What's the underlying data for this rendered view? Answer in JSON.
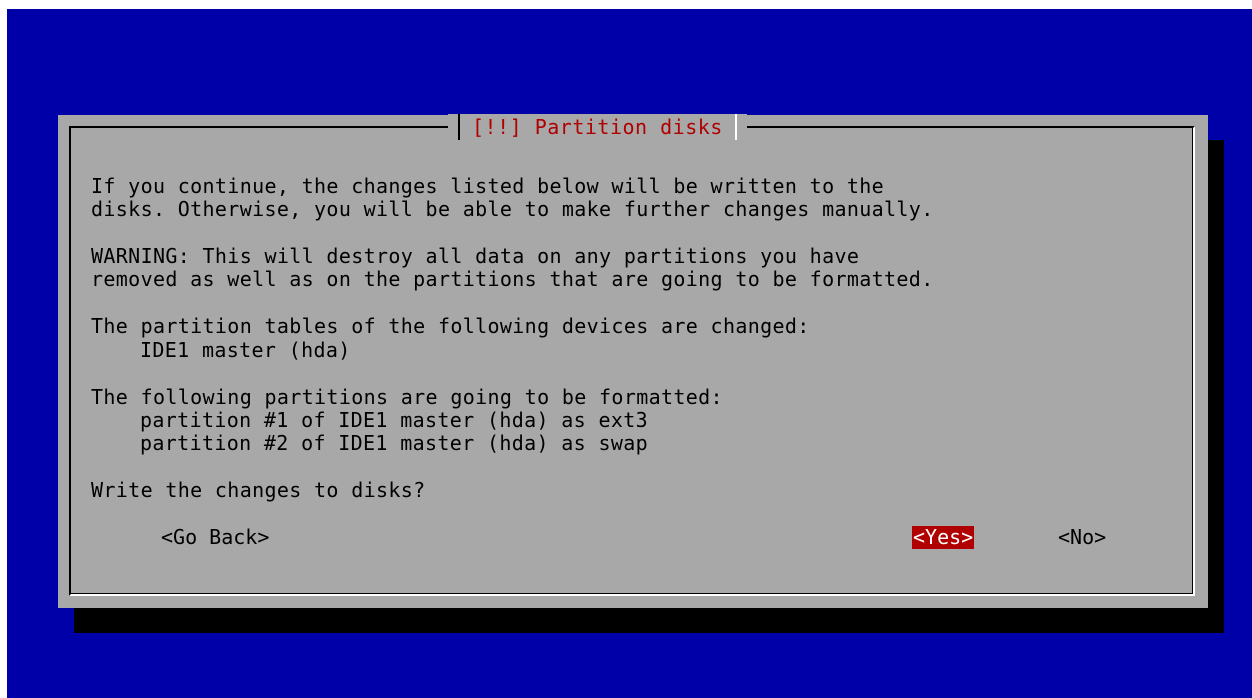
{
  "dialog": {
    "title": "[!!] Partition disks",
    "intro_line1": "If you continue, the changes listed below will be written to the",
    "intro_line2": "disks. Otherwise, you will be able to make further changes manually.",
    "warning_line1": "WARNING: This will destroy all data on any partitions you have",
    "warning_line2": "removed as well as on the partitions that are going to be formatted.",
    "tables_heading": "The partition tables of the following devices are changed:",
    "changed_devices": [
      "IDE1 master (hda)"
    ],
    "format_heading": "The following partitions are going to be formatted:",
    "formatted_partitions": [
      "partition #1 of IDE1 master (hda) as ext3",
      "partition #2 of IDE1 master (hda) as swap"
    ],
    "question": "Write the changes to disks?"
  },
  "buttons": {
    "go_back": "<Go Back>",
    "yes": "<Yes>",
    "no": "<No>",
    "selected": "yes"
  },
  "colors": {
    "desktop_background": "#0000a8",
    "dialog_background": "#a8a8a8",
    "title_color": "#b00000",
    "selected_button_background": "#b00000",
    "selected_button_text": "#ffffff"
  }
}
